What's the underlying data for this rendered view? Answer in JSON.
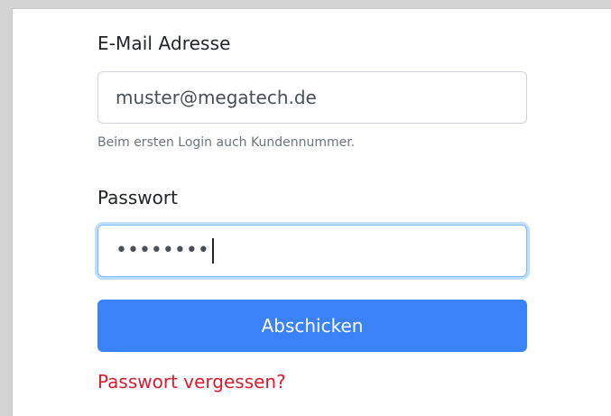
{
  "form": {
    "email_label": "E-Mail Adresse",
    "email_value": "muster@megatech.de",
    "email_help": "Beim ersten Login auch Kundennummer.",
    "password_label": "Passwort",
    "password_masked": "••••••••",
    "submit_label": "Abschicken",
    "forgot_label": "Passwort vergessen?"
  },
  "colors": {
    "primary": "#3b82f6",
    "link_danger": "#dc1c2e",
    "focus_border": "#80bdff"
  }
}
